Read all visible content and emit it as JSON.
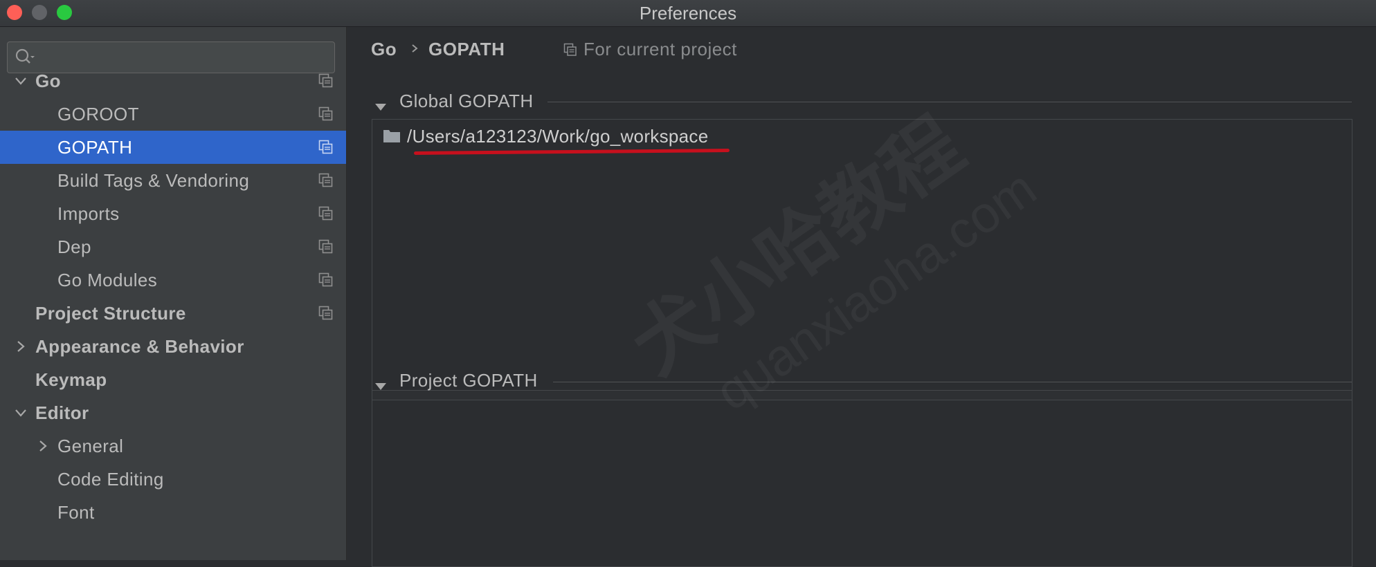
{
  "window": {
    "title": "Preferences"
  },
  "search": {
    "placeholder": ""
  },
  "sidebar": {
    "items": [
      {
        "label": "Go"
      },
      {
        "label": "GOROOT"
      },
      {
        "label": "GOPATH"
      },
      {
        "label": "Build Tags & Vendoring"
      },
      {
        "label": "Imports"
      },
      {
        "label": "Dep"
      },
      {
        "label": "Go Modules"
      },
      {
        "label": "Project Structure"
      },
      {
        "label": "Appearance & Behavior"
      },
      {
        "label": "Keymap"
      },
      {
        "label": "Editor"
      },
      {
        "label": "General"
      },
      {
        "label": "Code Editing"
      },
      {
        "label": "Font"
      }
    ]
  },
  "breadcrumb": {
    "parent": "Go",
    "current": "GOPATH",
    "scope": "For current project"
  },
  "global_gopath": {
    "title": "Global GOPATH",
    "paths": [
      "/Users/a123123/Work/go_workspace"
    ]
  },
  "project_gopath": {
    "title": "Project GOPATH"
  },
  "watermark": {
    "line1": "犬小哈教程",
    "line2": "quanxiaoha.com"
  },
  "colors": {
    "selected": "#2f65ca",
    "underline": "#c7101d"
  }
}
